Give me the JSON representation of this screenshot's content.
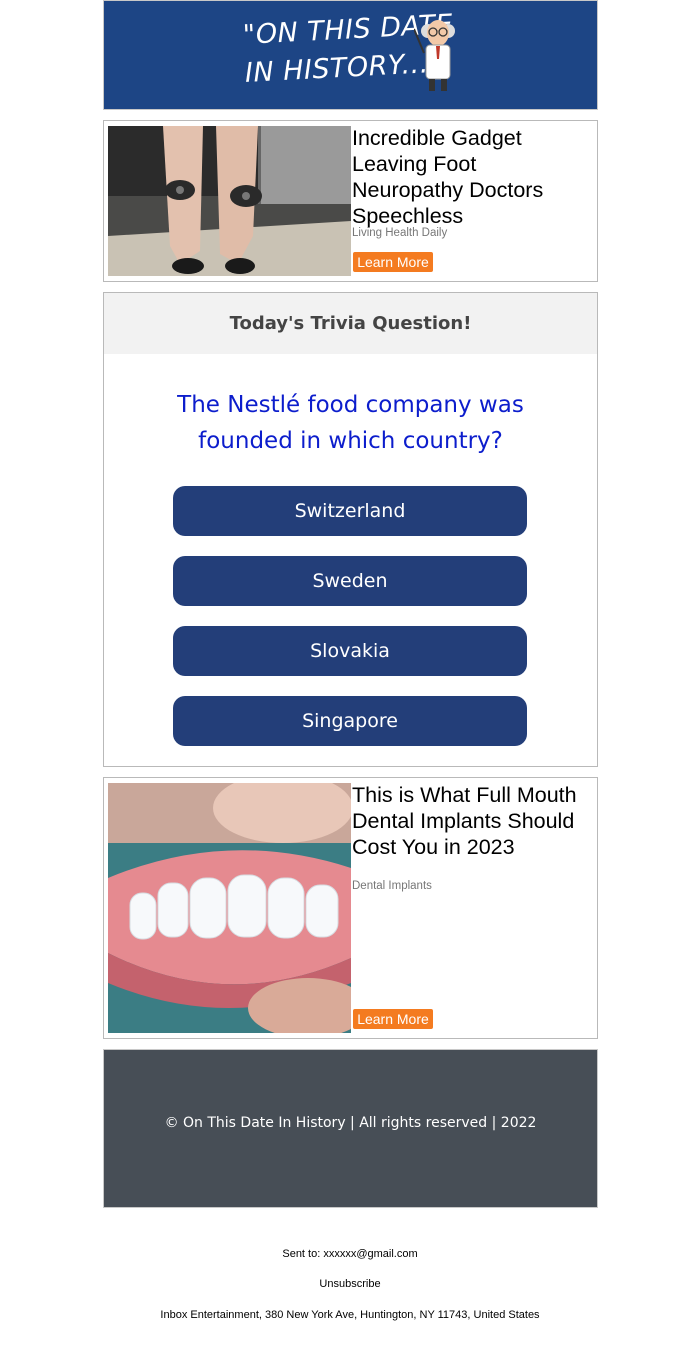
{
  "header": {
    "logo_line1": "\"ON THIS DATE",
    "logo_line2": "IN HISTORY...\""
  },
  "ad1": {
    "title": "Incredible Gadget Leaving Foot Neuropathy Doctors Speechless",
    "source": "Living Health Daily",
    "button": "Learn More"
  },
  "trivia": {
    "heading": "Today's Trivia Question!",
    "question": "The Nestlé food company was founded in which country?",
    "answers": [
      "Switzerland",
      "Sweden",
      "Slovakia",
      "Singapore"
    ]
  },
  "ad2": {
    "title": "This is What Full Mouth Dental Implants Should Cost You in 2023",
    "source": "Dental Implants",
    "button": "Learn More"
  },
  "footer": {
    "copyright": "© On This Date In History | All rights reserved | 2022"
  },
  "bottom": {
    "sent_to": "Sent to: xxxxxx@gmail.com",
    "unsubscribe": "Unsubscribe",
    "address": "Inbox Entertainment, 380 New York Ave, Huntington, NY 11743, United States"
  },
  "colors": {
    "header_bg": "#1d4585",
    "answer_bg": "#233e79",
    "question_text": "#0c1dcc",
    "cta_orange": "#f47b20",
    "footer_bg": "#474e56"
  }
}
